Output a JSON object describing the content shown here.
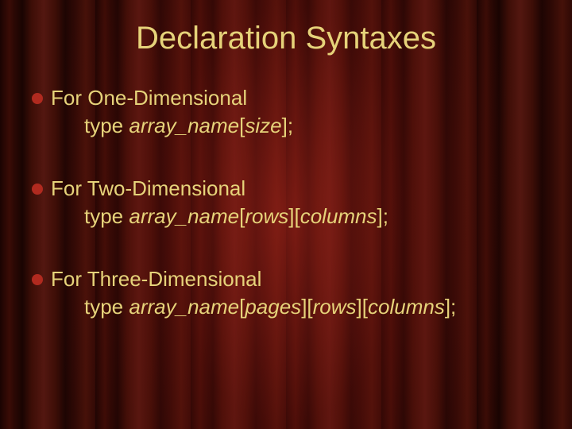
{
  "title": "Declaration Syntaxes",
  "items": [
    {
      "heading": "For One-Dimensional",
      "syntax": [
        {
          "t": "type ",
          "i": false
        },
        {
          "t": "array_name",
          "i": true
        },
        {
          "t": "[",
          "i": false
        },
        {
          "t": "size",
          "i": true
        },
        {
          "t": "];",
          "i": false
        }
      ]
    },
    {
      "heading": "For Two-Dimensional",
      "syntax": [
        {
          "t": "type ",
          "i": false
        },
        {
          "t": "array_name",
          "i": true
        },
        {
          "t": "[",
          "i": false
        },
        {
          "t": "rows",
          "i": true
        },
        {
          "t": "][",
          "i": false
        },
        {
          "t": "columns",
          "i": true
        },
        {
          "t": "];",
          "i": false
        }
      ]
    },
    {
      "heading": "For Three-Dimensional",
      "syntax": [
        {
          "t": "type ",
          "i": false
        },
        {
          "t": "array_name",
          "i": true
        },
        {
          "t": "[",
          "i": false
        },
        {
          "t": "pages",
          "i": true
        },
        {
          "t": "][",
          "i": false
        },
        {
          "t": "rows",
          "i": true
        },
        {
          "t": "][",
          "i": false
        },
        {
          "t": "columns",
          "i": true
        },
        {
          "t": "];",
          "i": false
        }
      ]
    }
  ]
}
